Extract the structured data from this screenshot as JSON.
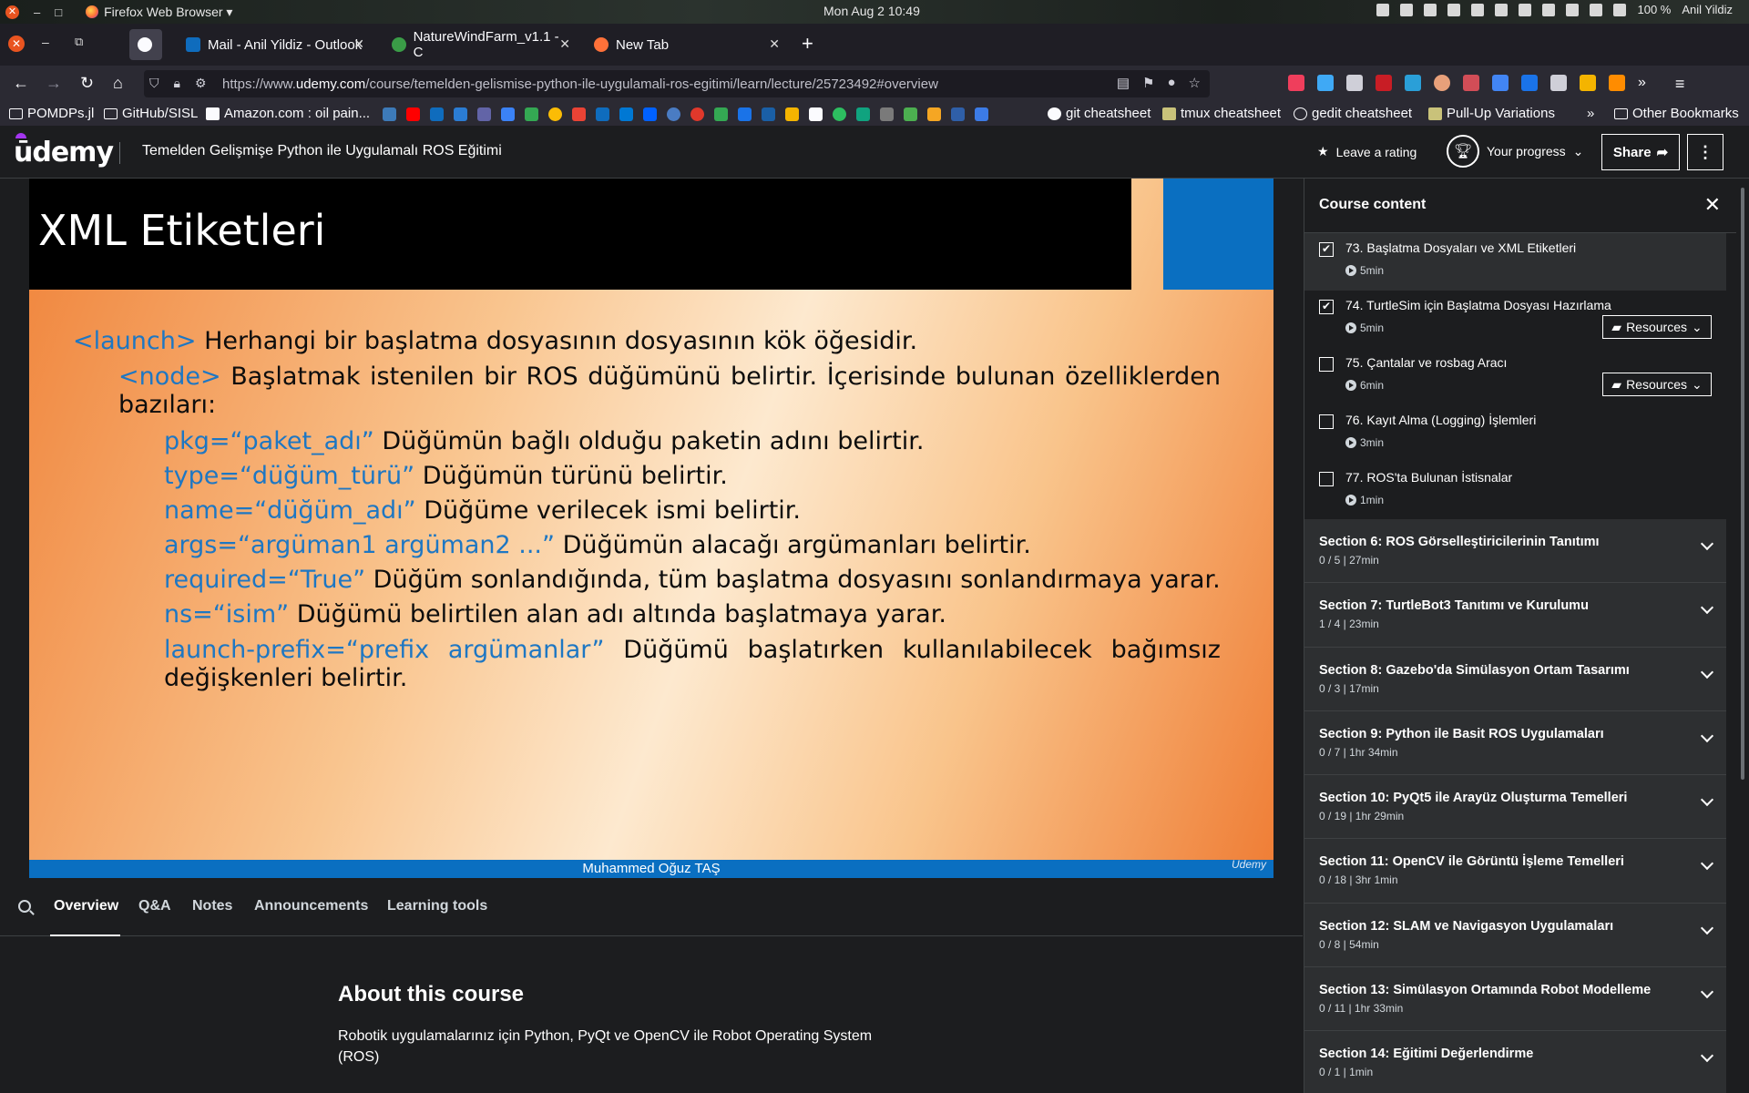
{
  "system": {
    "app_menu": "Firefox Web Browser ▾",
    "clock": "Mon Aug 2  10:49",
    "battery": "100 %",
    "user": "Anil Yildiz"
  },
  "browser": {
    "tabs": [
      {
        "label": "Mail - Anil Yildiz - Outlook",
        "favicon_color": "#0f6cbd"
      },
      {
        "label": "NatureWindFarm_v1.1 - C",
        "favicon_color": "#3a9c47"
      },
      {
        "label": "New Tab",
        "favicon_color": "#ff7139"
      }
    ],
    "url_prefix": "https://www.",
    "url_host": "udemy.com",
    "url_path": "/course/temelden-gelismise-python-ile-uygulamali-ros-egitimi/learn/lecture/25723492#overview",
    "bookmarks": {
      "pomdps": "POMDPs.jl",
      "github": "GitHub/SISL",
      "amazon": "Amazon.com : oil pain...",
      "git_cheat": "git cheatsheet",
      "tmux_cheat": "tmux cheatsheet",
      "gedit_cheat": "gedit cheatsheet",
      "pullup": "Pull-Up Variations",
      "other": "Other Bookmarks"
    }
  },
  "header": {
    "logo": "ūdemy",
    "course_title": "Temelden Gelişmişe Python ile Uygulamalı ROS Eğitimi",
    "rating": "Leave a rating",
    "progress": "Your progress",
    "share": "Share"
  },
  "slide": {
    "title": "XML Etiketleri",
    "footer": "Muhammed Oğuz TAŞ",
    "watermark": "Udemy",
    "launch_kw": "<launch>",
    "launch_txt": " Herhangi bir başlatma dosyasının dosyasının kök öğesidir.",
    "node_kw": "<node>",
    "node_txt": "  Başlatmak istenilen bir ROS düğümünü belirtir. İçerisinde bulunan özelliklerden bazıları:",
    "attrs": [
      {
        "kw": "pkg=“paket_adı”",
        "txt": " Düğümün bağlı olduğu paketin adını belirtir."
      },
      {
        "kw": "type=“düğüm_türü”",
        "txt": " Düğümün türünü belirtir."
      },
      {
        "kw": "name=“düğüm_adı”",
        "txt": " Düğüme verilecek ismi belirtir."
      },
      {
        "kw": "args=“argüman1 argüman2 ...”",
        "txt": " Düğümün alacağı argümanları belirtir."
      },
      {
        "kw": "required=“True”",
        "txt": " Düğüm sonlandığında, tüm başlatma dosyasını sonlandırmaya yarar."
      },
      {
        "kw": "ns=“isim”",
        "txt": " Düğümü belirtilen alan adı altında başlatmaya yarar."
      },
      {
        "kw": "launch-prefix=“prefix argümanlar”",
        "txt": "  Düğümü başlatırken kullanılabilecek bağımsız değişkenleri belirtir."
      }
    ]
  },
  "lecture_tabs": [
    "Overview",
    "Q&A",
    "Notes",
    "Announcements",
    "Learning tools"
  ],
  "about": {
    "title": "About this course",
    "description": "Robotik uygulamalarınız için Python, PyQt ve OpenCV ile Robot Operating System (ROS)"
  },
  "sidebar": {
    "title": "Course content",
    "resources_label": "Resources",
    "lectures": [
      {
        "title": "73. Başlatma Dosyaları ve XML Etiketleri",
        "duration": "5min",
        "checked": true
      },
      {
        "title": "74. TurtleSim için Başlatma Dosyası Hazırlama",
        "duration": "5min",
        "checked": true
      },
      {
        "title": "75. Çantalar ve rosbag Aracı",
        "duration": "6min",
        "checked": false
      },
      {
        "title": "76. Kayıt Alma (Logging) İşlemleri",
        "duration": "3min",
        "checked": false
      },
      {
        "title": "77. ROS'ta Bulunan İstisnalar",
        "duration": "1min",
        "checked": false
      }
    ],
    "sections": [
      {
        "title": "Section 6: ROS Görselleştiricilerinin Tanıtımı",
        "meta": "0 / 5 | 27min"
      },
      {
        "title": "Section 7: TurtleBot3 Tanıtımı ve Kurulumu",
        "meta": "1 / 4 | 23min"
      },
      {
        "title": "Section 8: Gazebo'da Simülasyon Ortam Tasarımı",
        "meta": "0 / 3 | 17min"
      },
      {
        "title": "Section 9: Python ile Basit ROS Uygulamaları",
        "meta": "0 / 7 | 1hr 34min"
      },
      {
        "title": "Section 10: PyQt5 ile Arayüz Oluşturma Temelleri",
        "meta": "0 / 19 | 1hr 29min"
      },
      {
        "title": "Section 11: OpenCV ile Görüntü İşleme Temelleri",
        "meta": "0 / 18 | 3hr 1min"
      },
      {
        "title": "Section 12: SLAM ve Navigasyon Uygulamaları",
        "meta": "0 / 8 | 54min"
      },
      {
        "title": "Section 13: Simülasyon Ortamında Robot Modelleme",
        "meta": "0 / 11 | 1hr 33min"
      },
      {
        "title": "Section 14: Eğitimi Değerlendirme",
        "meta": "0 / 1 | 1min"
      }
    ]
  },
  "colors": {
    "accent": "#a435f0",
    "slide_blue": "#0a6fc1",
    "keyword": "#1e77c3"
  }
}
